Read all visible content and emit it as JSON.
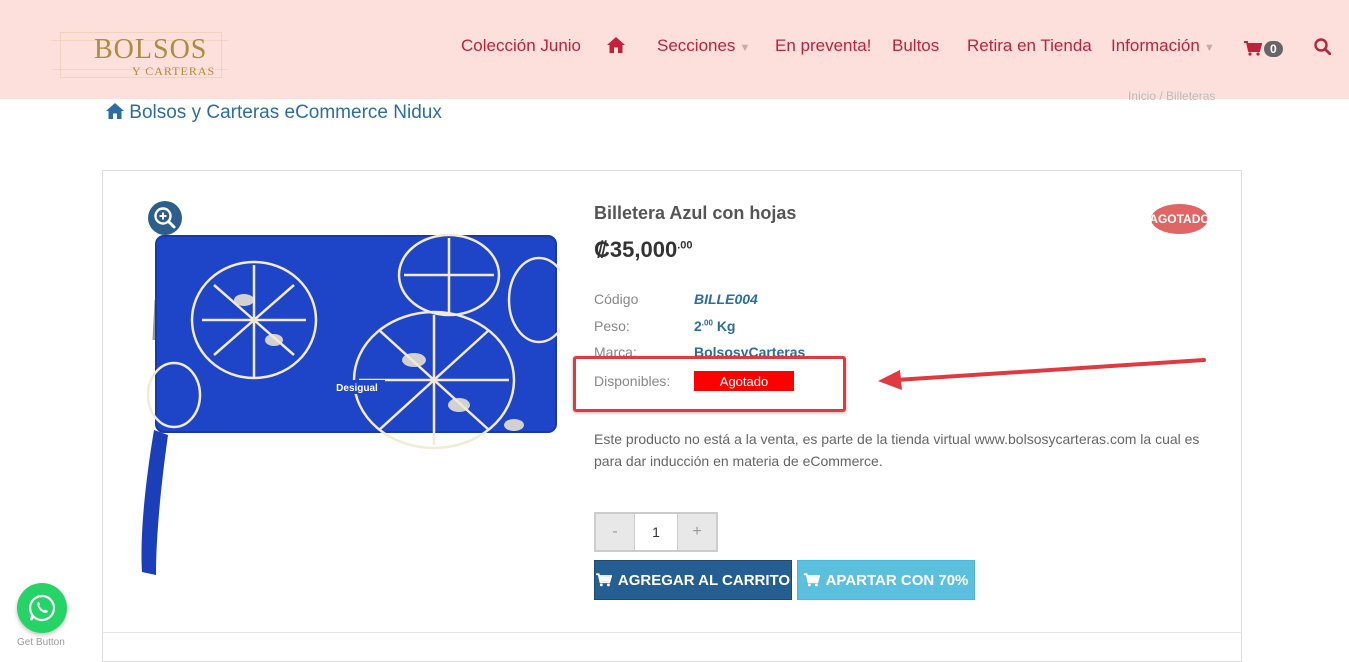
{
  "header": {
    "logo_main": "BOLSOS",
    "logo_sub": "Y CARTERAS",
    "nav": {
      "coleccion": "Colección Junio",
      "secciones": "Secciones",
      "preventa": "En preventa!",
      "bultos": "Bultos",
      "retira": "Retira en Tienda",
      "informacion": "Información",
      "cart_count": "0"
    }
  },
  "breadcrumb": {
    "title": "Bolsos y Carteras eCommerce Nidux",
    "right_trail": "Inicio  /  Billeteras"
  },
  "product": {
    "name": "Billetera Azul con hojas",
    "badge": "AGOTADO",
    "price_main": "₡35,000",
    "price_cents": ".00",
    "specs": {
      "codigo_label": "Código",
      "codigo_value": "BILLE004",
      "peso_label": "Peso:",
      "peso_value": "2",
      "peso_sup": ".00",
      "peso_unit": "Kg",
      "marca_label": "Marca:",
      "marca_value": "BolsosyCarteras",
      "disponibles_label": "Disponibles:",
      "disponibles_value": "Agotado"
    },
    "description": "Este producto no está a la venta, es parte de la tienda virtual www.bolsosycarteras.com la cual es para dar inducción en materia de eCommerce.",
    "quantity": {
      "minus": "-",
      "value": "1",
      "plus": "+"
    },
    "buttons": {
      "add_to_cart": "AGREGAR AL CARRITO",
      "reserve": "APARTAR CON 70%"
    },
    "brand_print": "Desigual"
  },
  "whatsapp": {
    "caption": "Get Button"
  },
  "colors": {
    "header_bg": "#fde0dc",
    "nav_text": "#c0223a",
    "link_blue": "#2e6da4",
    "primary_button": "#255e91",
    "info_button": "#5bc0de",
    "out_of_stock": "#ff0000",
    "annotation": "#e0393f"
  }
}
